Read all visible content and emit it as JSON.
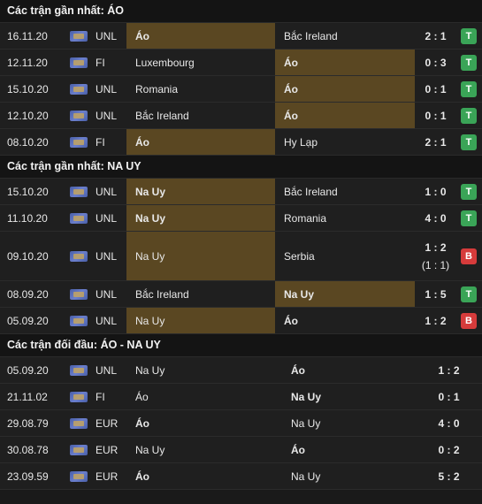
{
  "sections": [
    {
      "title": "Các trận gần nhất: ÁO",
      "rows": [
        {
          "date": "16.11.20",
          "league": "UNL",
          "home": "Áo",
          "away": "Bắc Ireland",
          "score": "2 : 1",
          "ht": "",
          "result": "T",
          "hl": "home"
        },
        {
          "date": "12.11.20",
          "league": "FI",
          "home": "Luxembourg",
          "away": "Áo",
          "score": "0 : 3",
          "ht": "",
          "result": "T",
          "hl": "away"
        },
        {
          "date": "15.10.20",
          "league": "UNL",
          "home": "Romania",
          "away": "Áo",
          "score": "0 : 1",
          "ht": "",
          "result": "T",
          "hl": "away"
        },
        {
          "date": "12.10.20",
          "league": "UNL",
          "home": "Bắc Ireland",
          "away": "Áo",
          "score": "0 : 1",
          "ht": "",
          "result": "T",
          "hl": "away"
        },
        {
          "date": "08.10.20",
          "league": "FI",
          "home": "Áo",
          "away": "Hy Lạp",
          "score": "2 : 1",
          "ht": "",
          "result": "T",
          "hl": "home"
        }
      ]
    },
    {
      "title": "Các trận gần nhất: NA UY",
      "rows": [
        {
          "date": "15.10.20",
          "league": "UNL",
          "home": "Na Uy",
          "away": "Bắc Ireland",
          "score": "1 : 0",
          "ht": "",
          "result": "T",
          "hl": "home"
        },
        {
          "date": "11.10.20",
          "league": "UNL",
          "home": "Na Uy",
          "away": "Romania",
          "score": "4 : 0",
          "ht": "",
          "result": "T",
          "hl": "home"
        },
        {
          "date": "09.10.20",
          "league": "UNL",
          "home": "Na Uy",
          "away": "Serbia",
          "score": "1 : 2",
          "ht": "(1 : 1)",
          "result": "B",
          "hl": "home-plain"
        },
        {
          "date": "08.09.20",
          "league": "UNL",
          "home": "Bắc Ireland",
          "away": "Na Uy",
          "score": "1 : 5",
          "ht": "",
          "result": "T",
          "hl": "away"
        },
        {
          "date": "05.09.20",
          "league": "UNL",
          "home": "Na Uy",
          "away": "Áo",
          "score": "1 : 2",
          "ht": "",
          "result": "B",
          "hl": "home-plain"
        }
      ]
    },
    {
      "title": "Các trận đối đầu: ÁO - NA UY",
      "rows": [
        {
          "date": "05.09.20",
          "league": "UNL",
          "home": "Na Uy",
          "away": "Áo",
          "score": "1 : 2",
          "bold": "away"
        },
        {
          "date": "21.11.02",
          "league": "FI",
          "home": "Áo",
          "away": "Na Uy",
          "score": "0 : 1",
          "bold": "away"
        },
        {
          "date": "29.08.79",
          "league": "EUR",
          "home": "Áo",
          "away": "Na Uy",
          "score": "4 : 0",
          "bold": "home"
        },
        {
          "date": "30.08.78",
          "league": "EUR",
          "home": "Na Uy",
          "away": "Áo",
          "score": "0 : 2",
          "bold": "away"
        },
        {
          "date": "23.09.59",
          "league": "EUR",
          "home": "Áo",
          "away": "Na Uy",
          "score": "5 : 2",
          "bold": "home"
        }
      ]
    }
  ],
  "colors": {
    "highlight": "#5a4722",
    "win": "#3aa457",
    "lose": "#d63b3b"
  },
  "icons": {
    "flag": "league-flag-icon"
  }
}
